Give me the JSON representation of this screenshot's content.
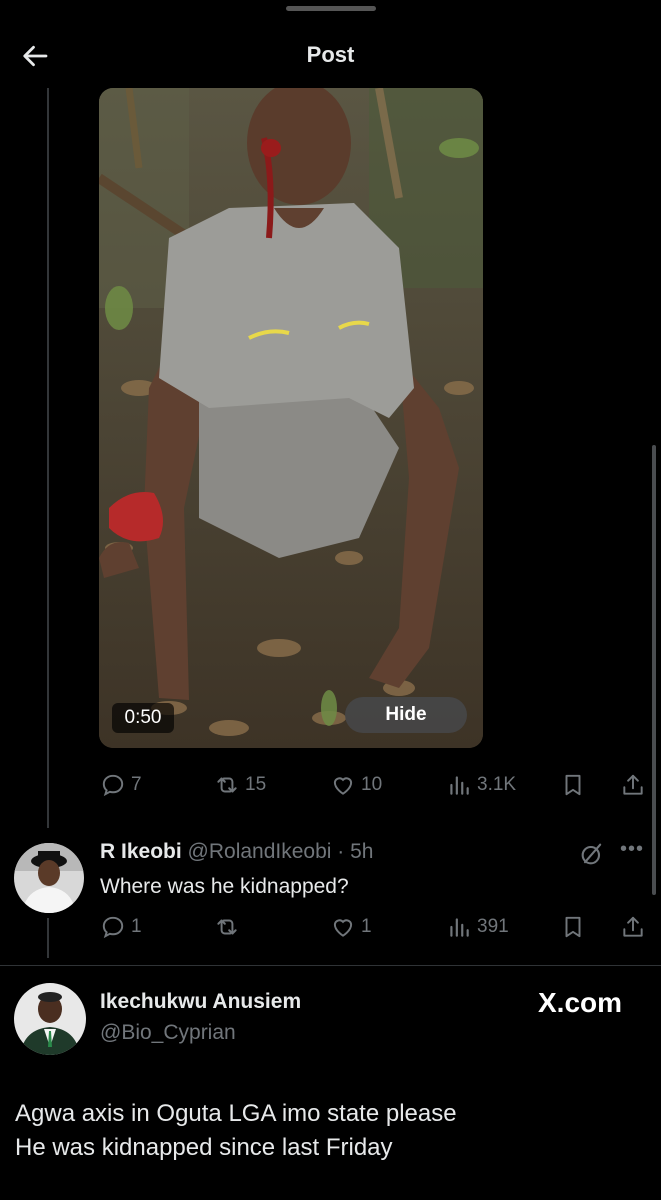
{
  "header": {
    "title": "Post"
  },
  "media": {
    "duration": "0:50",
    "hide_label": "Hide"
  },
  "main_tweet": {
    "actions": {
      "replies": "7",
      "reposts": "15",
      "likes": "10",
      "views": "3.1K"
    }
  },
  "reply": {
    "display_name": "R Ikeobi",
    "handle_time": "@RolandIkeobi · 5h",
    "text": "Where was he kidnapped?",
    "actions": {
      "replies": "1",
      "reposts": "",
      "likes": "1",
      "views": "391"
    }
  },
  "author": {
    "display_name": "Ikechukwu Anusiem",
    "handle": "@Bio_Cyprian"
  },
  "watermark": "X.com",
  "body": {
    "line1": "Agwa axis in Oguta LGA imo state please",
    "line2": "He was kidnapped since last Friday"
  },
  "colors": {
    "background": "#000000",
    "text": "#e7e9ea",
    "muted": "#71767b",
    "divider": "#2f3336"
  }
}
